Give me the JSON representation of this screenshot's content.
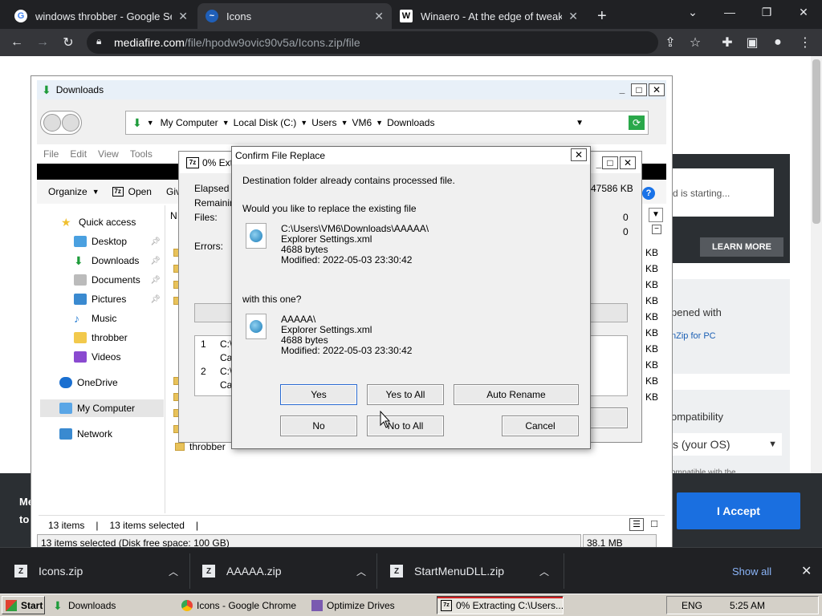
{
  "browser": {
    "tabs": [
      {
        "title": "windows throbber - Google Sear"
      },
      {
        "title": "Icons"
      },
      {
        "title": "Winaero - At the edge of tweakin"
      }
    ],
    "url_host": "mediafire.com",
    "url_path": "/file/hpodw9ovic90v5a/Icons.zip/file",
    "new_tab": "+",
    "close_symbol": "✕"
  },
  "page": {
    "starting_text": "d is starting...",
    "learn_more": "LEARN MORE",
    "opened_with": "pened with",
    "winzip_link": "nZip for PC",
    "compatibility": "ompatibility",
    "os_select": "s (your OS)",
    "compat_note": "ompatible with the",
    "banner_left_1": "Me",
    "banner_left_2": "to",
    "accept": "I Accept"
  },
  "explorer": {
    "title": "Downloads",
    "breadcrumb": [
      "My Computer",
      "Local Disk (C:)",
      "Users",
      "VM6",
      "Downloads"
    ],
    "menu": [
      "File",
      "Edit",
      "View",
      "Tools"
    ],
    "organize": "Organize",
    "open": "Open",
    "give": "Giv",
    "column_name": "N",
    "nav": [
      {
        "label": "Quick access"
      },
      {
        "label": "Desktop"
      },
      {
        "label": "Downloads"
      },
      {
        "label": "Documents"
      },
      {
        "label": "Pictures"
      },
      {
        "label": "Music"
      },
      {
        "label": "throbber"
      },
      {
        "label": "Videos"
      },
      {
        "label": "OneDrive"
      },
      {
        "label": "My Computer"
      },
      {
        "label": "Network"
      }
    ],
    "kb_unit": "KB",
    "last_file": "throbber",
    "status_items": "13 items",
    "status_selected": "13 items selected",
    "status_bar": "13 items selected (Disk free space: 100 GB)",
    "status_size": "38.1 MB",
    "sep": "|"
  },
  "extract": {
    "title": "0% Ext",
    "elapsed": "Elapsed ti",
    "remaining": "Remaining",
    "files": "Files:",
    "errors": "Errors:",
    "size": "47586 KB",
    "files_count": "0",
    "errors_count": "0",
    "log_1_num": "1",
    "log_1_a": "C:\\",
    "log_1_b": "Ca",
    "log_2_num": "2",
    "log_2_a": "C:\\",
    "log_2_b": "Ca"
  },
  "confirm": {
    "title": "Confirm File Replace",
    "line1": "Destination folder already contains processed file.",
    "line2": "Would you like to replace the existing file",
    "existing": {
      "path": "C:\\Users\\VM6\\Downloads\\AAAAA\\",
      "name": "Explorer Settings.xml",
      "size": "4688 bytes",
      "modified": "Modified: 2022-05-03 23:30:42"
    },
    "with_this": "with this one?",
    "incoming": {
      "path": "AAAAA\\",
      "name": "Explorer Settings.xml",
      "size": "4688 bytes",
      "modified": "Modified: 2022-05-03 23:30:42"
    },
    "buttons": {
      "yes": "Yes",
      "yes_all": "Yes to All",
      "auto_rename": "Auto Rename",
      "no": "No",
      "no_all": "No to All",
      "cancel": "Cancel"
    }
  },
  "downloads_bar": {
    "items": [
      {
        "name": "Icons.zip"
      },
      {
        "name": "AAAAA.zip"
      },
      {
        "name": "StartMenuDLL.zip"
      }
    ],
    "show_all": "Show all"
  },
  "taskbar": {
    "start": "Start",
    "items": [
      {
        "label": "Downloads"
      },
      {
        "label": "Icons - Google Chrome"
      },
      {
        "label": "Optimize Drives"
      },
      {
        "label": "0% Extracting C:\\Users..."
      }
    ],
    "lang": "ENG",
    "time": "5:25 AM"
  },
  "colors": {
    "chrome_dark": "#202124",
    "accept_blue": "#1a6fe0",
    "taskbar": "#d4d0c8"
  }
}
